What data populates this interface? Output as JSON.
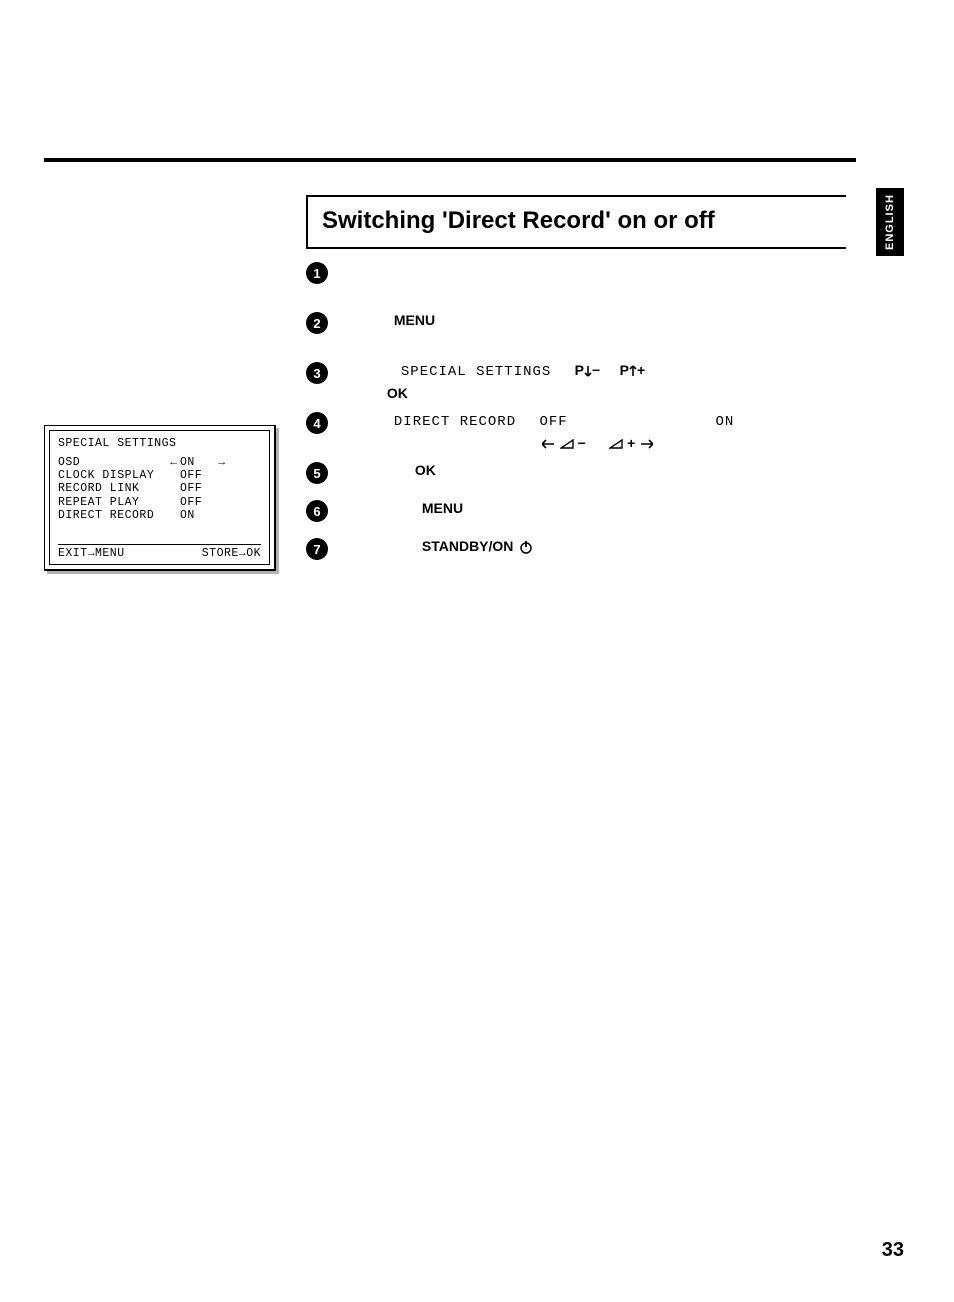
{
  "language_tab": "ENGLISH",
  "title": "Switching 'Direct Record' on or off",
  "steps": {
    "s2_menu": "MENU",
    "s3_special": "SPECIAL SETTINGS",
    "s3_pdown": "P",
    "s3_minus": "−",
    "s3_pup": "P",
    "s3_plus": "+",
    "s3_ok": "OK",
    "s4_direct": "DIRECT RECORD",
    "s4_off": "OFF",
    "s4_on": "ON",
    "s4_volminus": "−",
    "s4_volplus": "+",
    "s5_ok": "OK",
    "s6_menu": "MENU",
    "s7_standby": "STANDBY/ON"
  },
  "screen": {
    "title": "SPECIAL SETTINGS",
    "rows": [
      {
        "label": "OSD",
        "left": "←",
        "value": "ON",
        "right": "→"
      },
      {
        "label": "CLOCK DISPLAY",
        "left": "",
        "value": "OFF",
        "right": ""
      },
      {
        "label": "RECORD LINK",
        "left": "",
        "value": "OFF",
        "right": ""
      },
      {
        "label": "REPEAT PLAY",
        "left": "",
        "value": "OFF",
        "right": ""
      },
      {
        "label": "DIRECT RECORD",
        "left": "",
        "value": "ON",
        "right": ""
      }
    ],
    "footer_left": "EXIT→MENU",
    "footer_right": "STORE→OK"
  },
  "page_number": "33"
}
